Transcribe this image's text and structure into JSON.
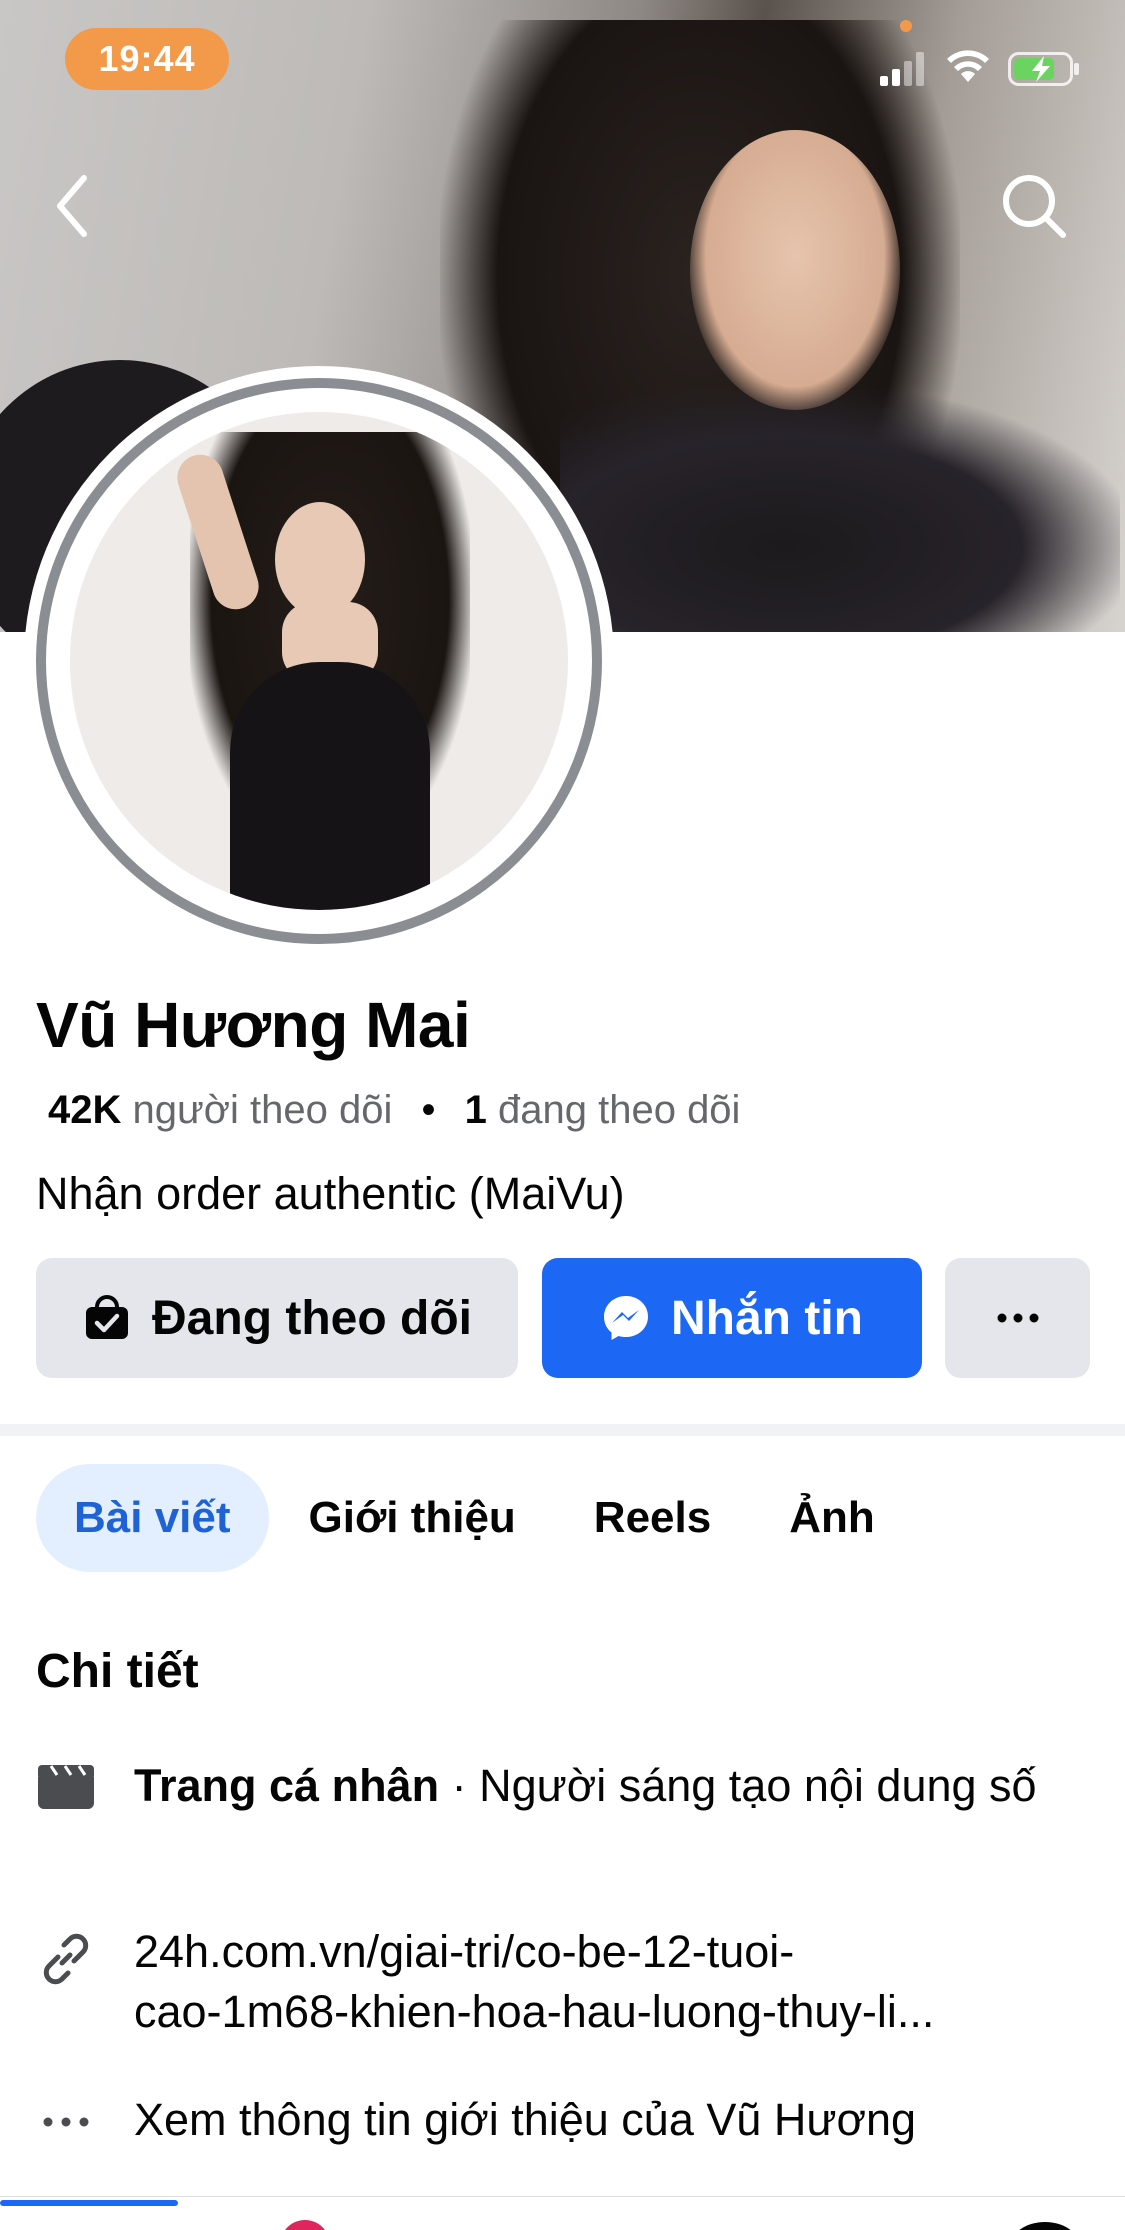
{
  "status_bar": {
    "time": "19:44"
  },
  "profile": {
    "name": "Vũ Hương Mai",
    "followers_count": "42K",
    "followers_label": "người theo dõi",
    "following_count": "1",
    "following_label": "đang theo dõi",
    "bio": "Nhận order authentic (MaiVu)"
  },
  "actions": {
    "following_label": "Đang theo dõi",
    "message_label": "Nhắn tin",
    "more_label": "···"
  },
  "tabs": [
    {
      "label": "Bài viết",
      "active": true
    },
    {
      "label": "Giới thiệu",
      "active": false
    },
    {
      "label": "Reels",
      "active": false
    },
    {
      "label": "Ảnh",
      "active": false
    }
  ],
  "details": {
    "title": "Chi tiết",
    "page_type_bold": "Trang cá nhân",
    "page_type_rest": " · Người sáng tạo nội dung số",
    "link_line1": "24h.com.vn/giai-tri/co-be-12-tuoi-",
    "link_line2": "cao-1m68-khien-hoa-hau-luong-thuy-li...",
    "see_more": "Xem thông tin giới thiệu của Vũ Hương"
  },
  "icons": {
    "back": "chevron-left-icon",
    "search": "search-icon",
    "following": "follow-check-icon",
    "message": "messenger-icon",
    "page": "clapperboard-icon",
    "link": "link-icon",
    "more": "ellipsis-icon"
  },
  "colors": {
    "accent": "#1d67f5",
    "time_pill": "#f29a4a",
    "tab_active_bg": "#e3efff",
    "tab_active_text": "#1f62d6",
    "button_gray": "#e4e6eb"
  }
}
